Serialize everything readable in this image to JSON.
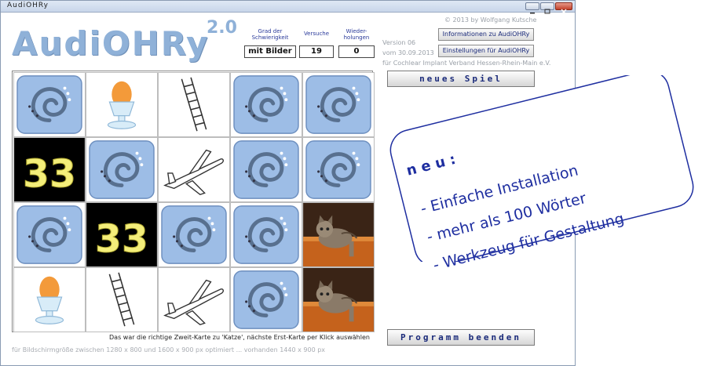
{
  "window": {
    "title": "AudiOHRy"
  },
  "logo": {
    "name": "AudiOHRy",
    "version": "2.0"
  },
  "stats": {
    "difficulty": {
      "label": "Grad der Schwierigkeit",
      "value": "mit Bilder"
    },
    "attempts": {
      "label": "Versuche",
      "value": "19"
    },
    "repeats": {
      "label": "Wieder-holungen",
      "value": "0"
    }
  },
  "info": {
    "copyright": "© 2013 by Wolfgang Kutsche",
    "version": "Version 06",
    "date": "vom 30.09.2013",
    "org": "für Cochlear Implant Verband Hessen-Rhein-Main e.V."
  },
  "buttons": {
    "info": "Informationen zu AudiOHRy",
    "settings": "Einstellungen für AudiOHRy",
    "new_game": "neues Spiel",
    "quit": "Programm beenden"
  },
  "status": "Das war die richtige Zweit-Karte zu 'Katze', nächste Erst-Karte per Klick auswählen",
  "footer": "für Bildschirmgröße zwischen 1280 x 800 und 1600 x 900 px optimiert ... vorhanden 1440 x 900 px",
  "cards": [
    [
      "ear",
      "egg",
      "ladder",
      "ear",
      "ear"
    ],
    [
      "number",
      "ear",
      "airplane",
      "ear",
      "ear"
    ],
    [
      "ear",
      "number",
      "ear",
      "ear",
      "cat"
    ],
    [
      "egg",
      "ladder",
      "airplane",
      "ear",
      "cat"
    ]
  ],
  "card_number_text": "33",
  "callout": {
    "heading": "n e u :",
    "items": [
      "- Einfache Installation",
      "- mehr als 100 Wörter",
      "- Werkzeug für Gestaltung"
    ]
  },
  "colors": {
    "accent": "#1e2ea0",
    "logo": "#8fb1d8",
    "card_back": "#9dbde6"
  }
}
